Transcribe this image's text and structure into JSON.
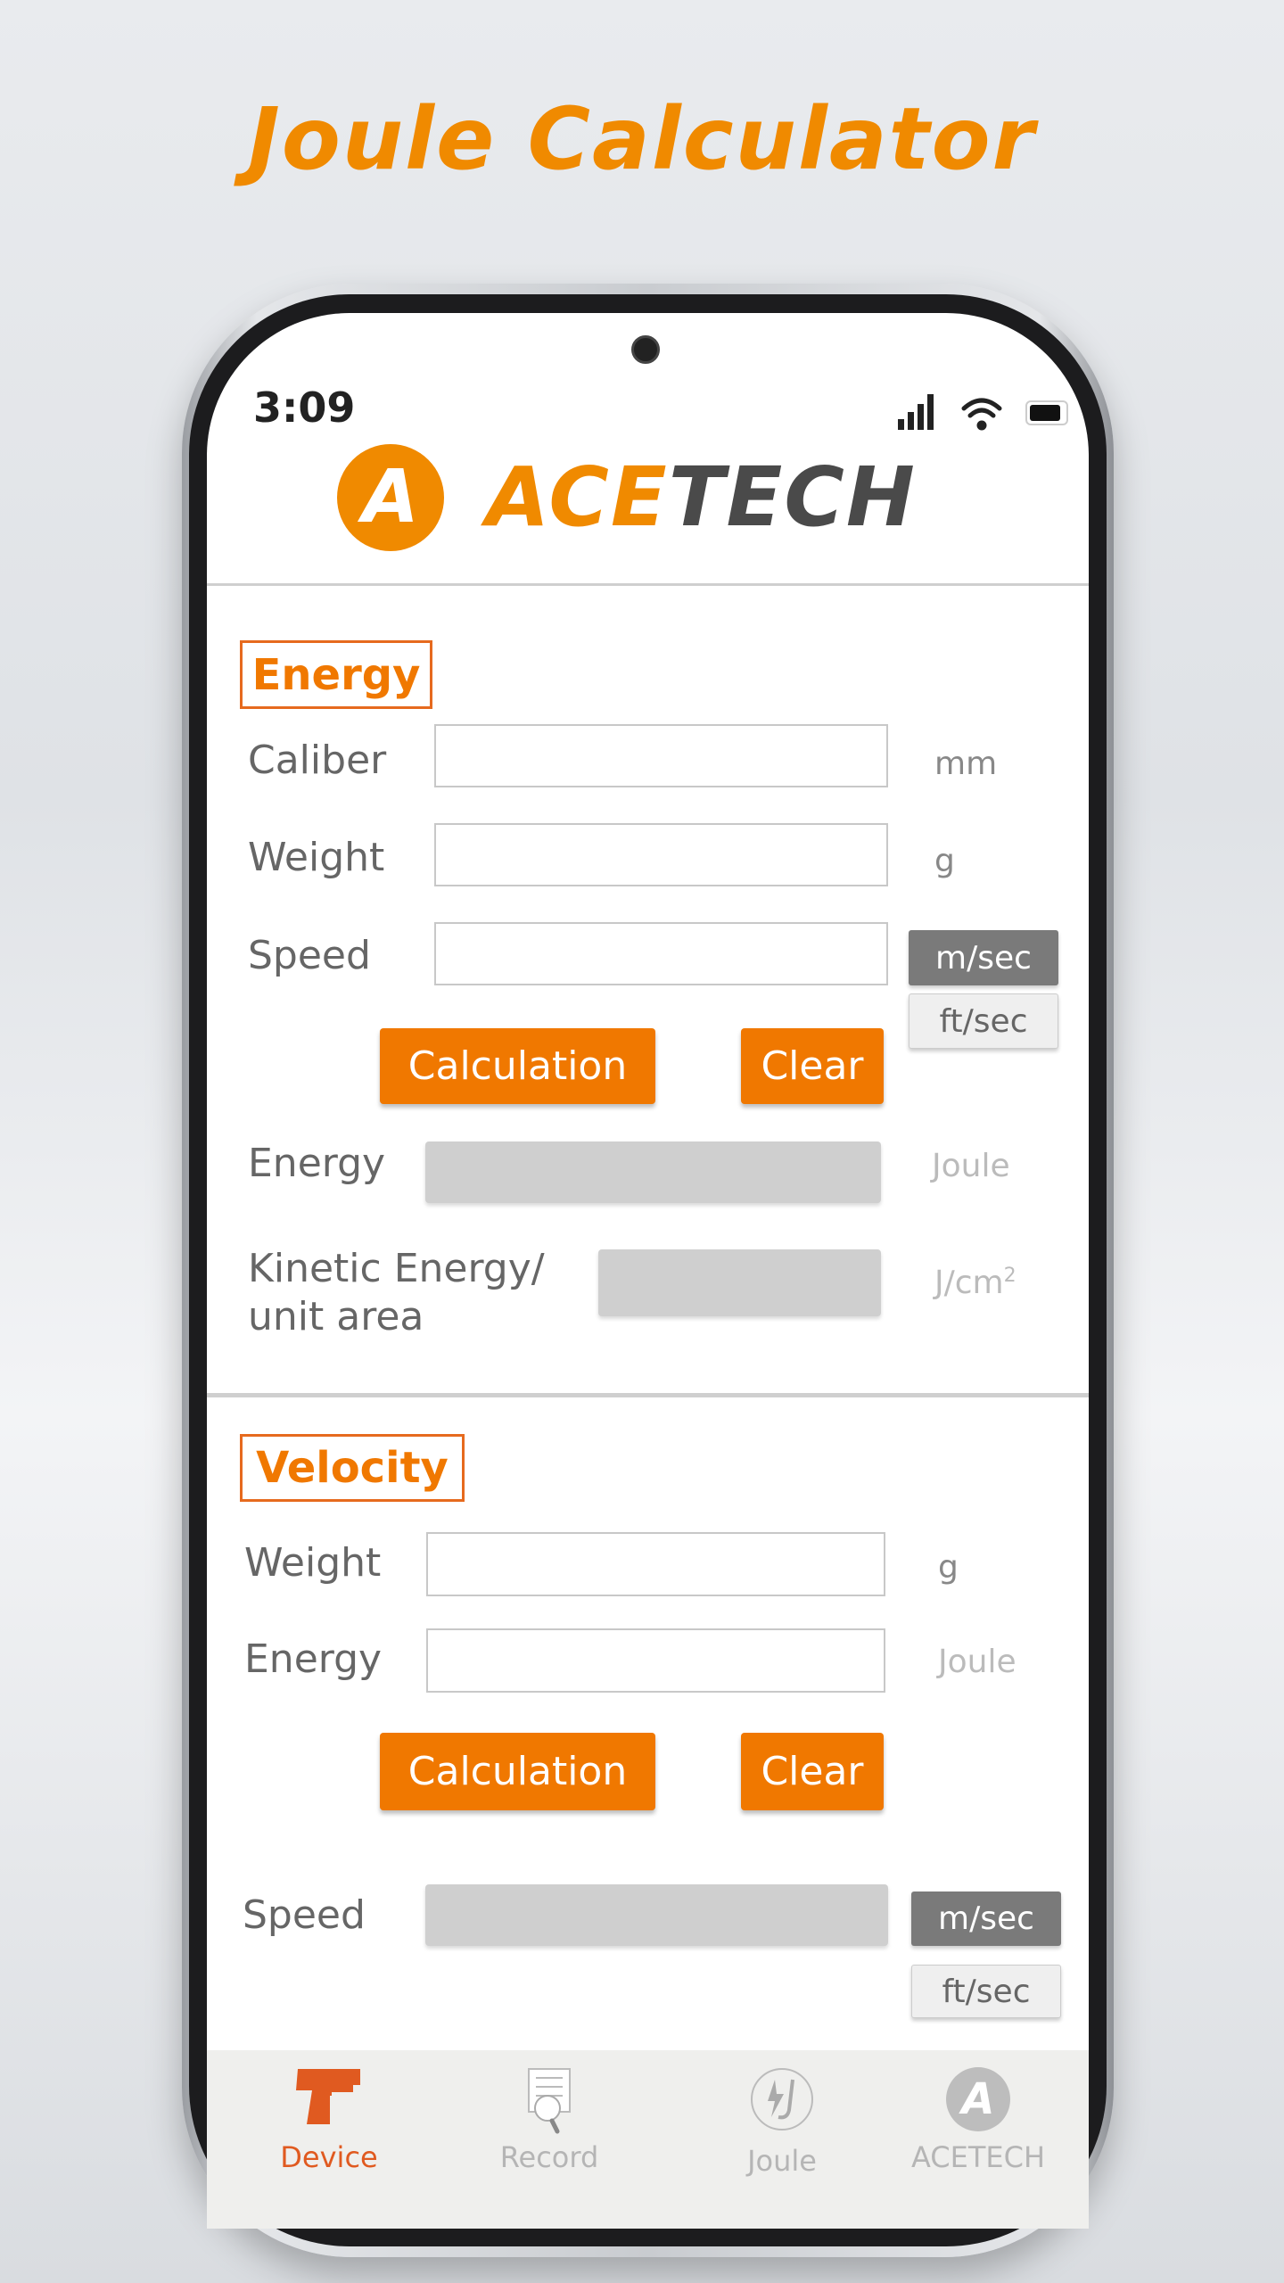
{
  "title": "Joule Calculator",
  "status_bar": {
    "time": "3:09",
    "icons": [
      "signal-icon",
      "wifi-icon",
      "battery-icon"
    ]
  },
  "brand": {
    "logo_letter": "A",
    "name_part1": "ACE",
    "name_part2": "TECH"
  },
  "colors": {
    "accent": "#f07800",
    "active_tab": "#e05a20",
    "inactive": "#b5b5b5"
  },
  "energy": {
    "section_label": "Energy",
    "caliber": {
      "label": "Caliber",
      "value": "",
      "unit": "mm"
    },
    "weight": {
      "label": "Weight",
      "value": "",
      "unit": "g"
    },
    "speed": {
      "label": "Speed",
      "value": "",
      "unit_options": [
        "m/sec",
        "ft/sec"
      ],
      "selected_unit": "m/sec"
    },
    "calc_label": "Calculation",
    "clear_label": "Clear",
    "energy_out": {
      "label": "Energy",
      "value": "",
      "unit": "Joule"
    },
    "ke_out": {
      "label_line1": "Kinetic Energy/",
      "label_line2": "unit area",
      "value": "",
      "unit": "J/cm",
      "unit_sup": "2"
    }
  },
  "velocity": {
    "section_label": "Velocity",
    "weight": {
      "label": "Weight",
      "value": "",
      "unit": "g"
    },
    "energy": {
      "label": "Energy",
      "value": "",
      "unit": "Joule"
    },
    "calc_label": "Calculation",
    "clear_label": "Clear",
    "speed_out": {
      "label": "Speed",
      "value": "",
      "unit_options": [
        "m/sec",
        "ft/sec"
      ],
      "selected_unit": "m/sec"
    }
  },
  "tabs": [
    {
      "label": "Device",
      "icon": "pistol-icon",
      "active": true
    },
    {
      "label": "Record",
      "icon": "document-search-icon",
      "active": false
    },
    {
      "label": "Joule",
      "icon": "joule-icon",
      "active": false
    },
    {
      "label": "ACETECH",
      "icon": "acetech-logo-icon",
      "active": false
    }
  ]
}
